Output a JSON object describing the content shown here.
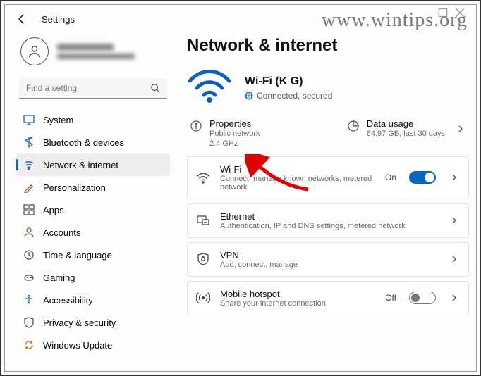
{
  "watermark": "www.wintips.org",
  "header": {
    "title": "Settings"
  },
  "search": {
    "placeholder": "Find a setting"
  },
  "sidebar": {
    "items": [
      {
        "label": "System"
      },
      {
        "label": "Bluetooth & devices"
      },
      {
        "label": "Network & internet"
      },
      {
        "label": "Personalization"
      },
      {
        "label": "Apps"
      },
      {
        "label": "Accounts"
      },
      {
        "label": "Time & language"
      },
      {
        "label": "Gaming"
      },
      {
        "label": "Accessibility"
      },
      {
        "label": "Privacy & security"
      },
      {
        "label": "Windows Update"
      }
    ]
  },
  "page": {
    "title": "Network & internet",
    "hero_name": "Wi-Fi (K G)",
    "hero_status": "Connected, secured",
    "properties_h": "Properties",
    "properties_s1": "Public network",
    "properties_s2": "2.4 GHz",
    "usage_h": "Data usage",
    "usage_s": "64.97 GB, last 30 days"
  },
  "cards": {
    "wifi_h": "Wi-Fi",
    "wifi_s": "Connect, manage known networks, metered network",
    "wifi_state": "On",
    "eth_h": "Ethernet",
    "eth_s": "Authentication, IP and DNS settings, metered network",
    "vpn_h": "VPN",
    "vpn_s": "Add, connect, manage",
    "hot_h": "Mobile hotspot",
    "hot_s": "Share your internet connection",
    "hot_state": "Off"
  }
}
